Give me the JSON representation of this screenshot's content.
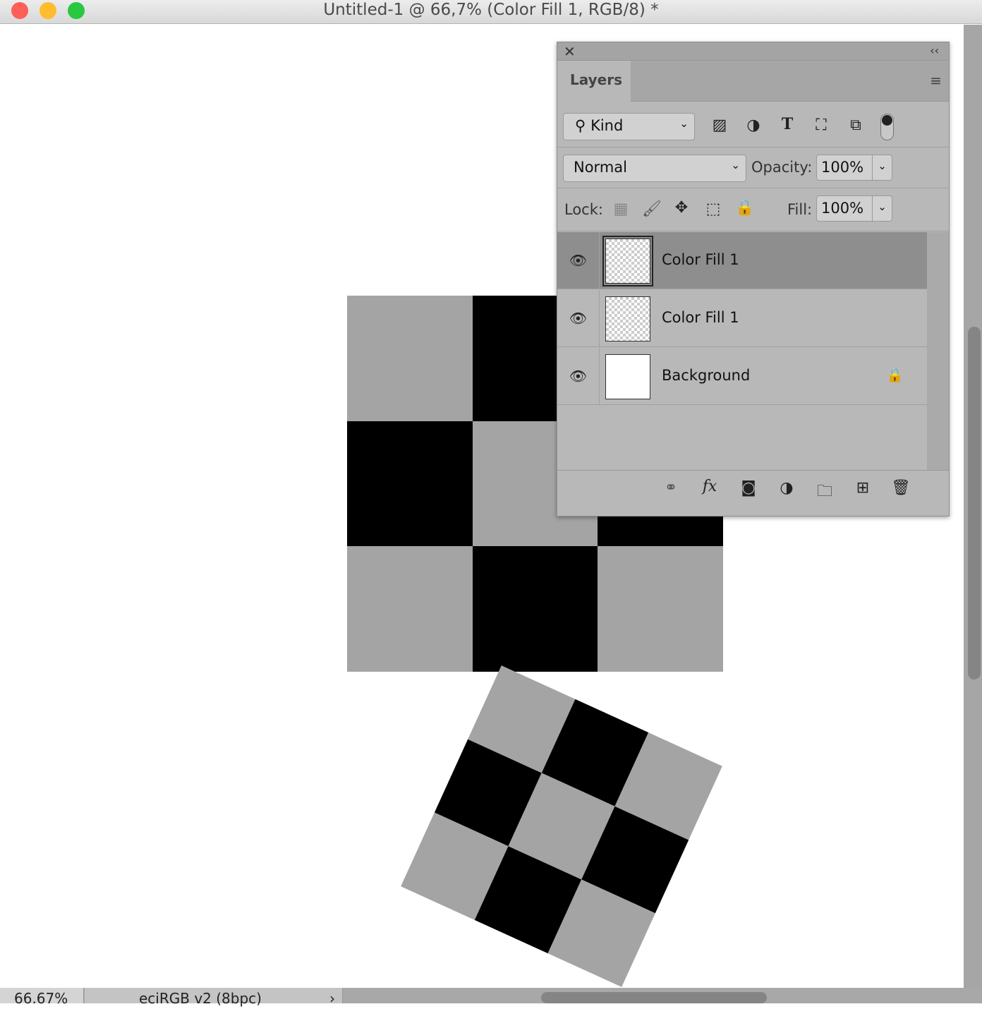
{
  "window": {
    "title": "Untitled-1 @ 66,7% (Color Fill 1, RGB/8) *"
  },
  "panel": {
    "tab": "Layers",
    "close_icon": "close-icon",
    "collapse_icon": "double-chevron-left-icon",
    "menu_icon": "hamburger-menu-icon",
    "filter": {
      "label": "Kind"
    },
    "blend_mode": "Normal",
    "opacity_label": "Opacity:",
    "opacity": "100%",
    "lock_label": "Lock:",
    "fill_label": "Fill:",
    "fill": "100%",
    "layers": [
      {
        "name": "Color Fill 1",
        "selected": true,
        "visible": true
      },
      {
        "name": "Color Fill 1",
        "selected": false,
        "visible": true
      },
      {
        "name": "Background",
        "selected": false,
        "visible": true,
        "locked": true
      }
    ]
  },
  "status": {
    "zoom": "66.67%",
    "profile": "eciRGB v2 (8bpc)",
    "arrow": "›"
  },
  "colors": {
    "checker_gray": "#a4a4a4",
    "checker_black": "#000000",
    "panel_bg": "#b8b8b8",
    "selected_layer": "#8e8e8e"
  }
}
